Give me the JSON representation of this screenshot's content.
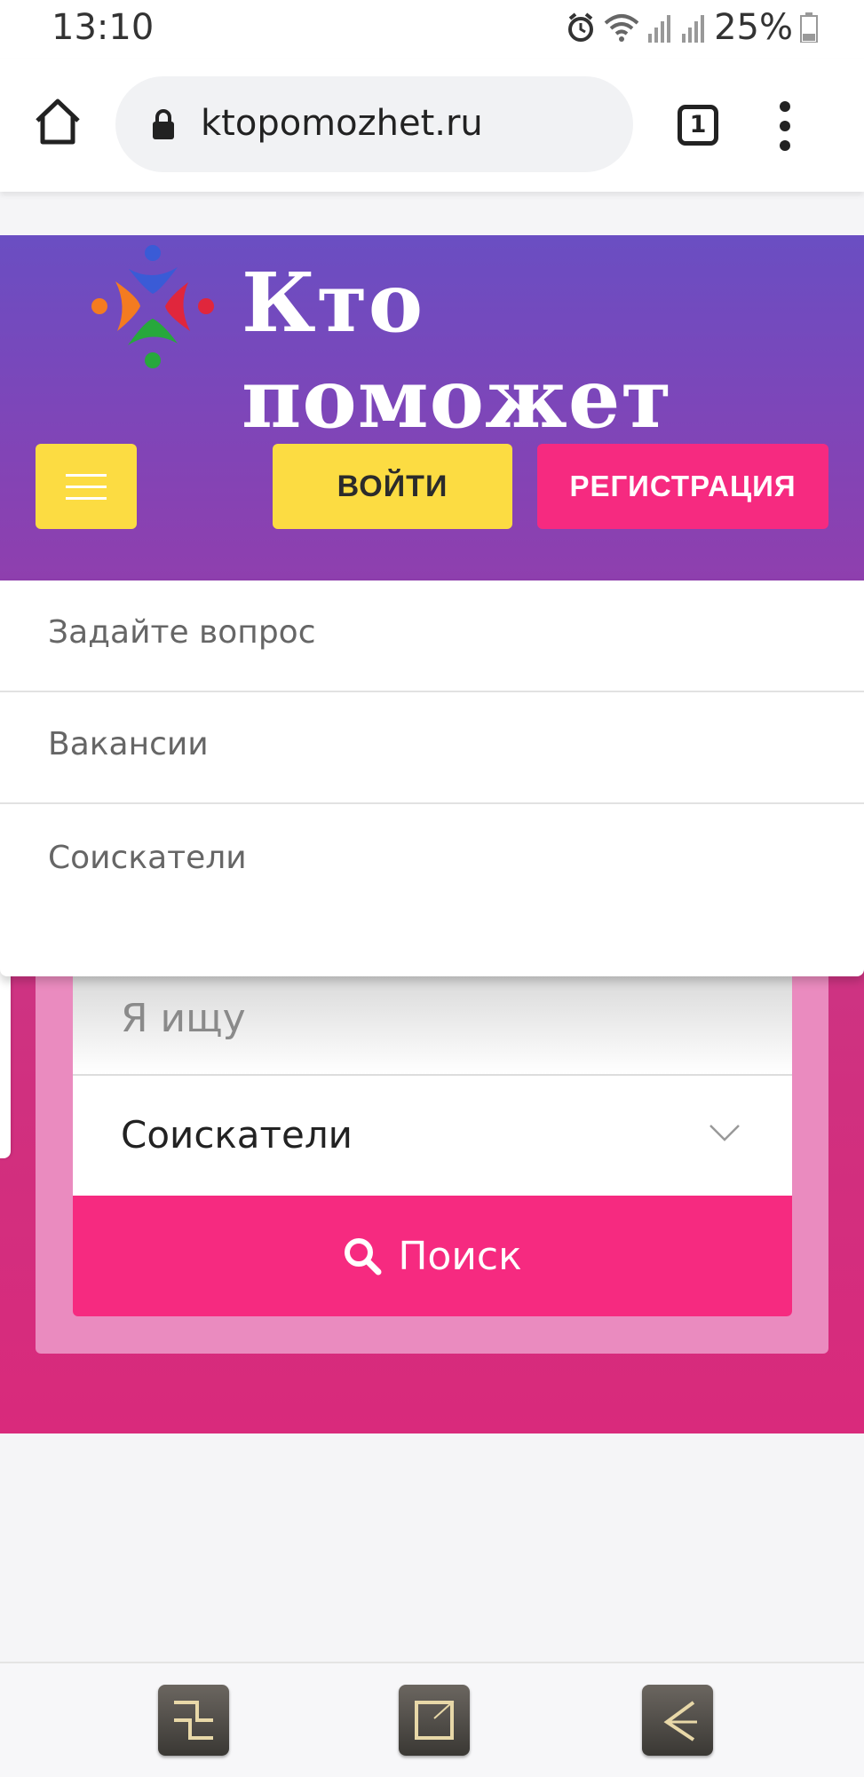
{
  "status_bar": {
    "time": "13:10",
    "battery": "25%"
  },
  "browser": {
    "url": "ktopomozhet.ru",
    "tab_count": "1"
  },
  "site": {
    "logo_text": "Кто поможет",
    "login_label": "ВОЙТИ",
    "register_label": "РЕГИСТРАЦИЯ"
  },
  "menu": {
    "items": [
      {
        "label": "Задайте вопрос"
      },
      {
        "label": "Вакансии"
      },
      {
        "label": "Соискатели"
      }
    ]
  },
  "search": {
    "placeholder": "Я ищу",
    "selected_category": "Соискатели",
    "button_label": "Поиск"
  },
  "colors": {
    "header": "#6a4ec2",
    "accent_yellow": "#fcdc42",
    "accent_pink": "#f62a80",
    "hero_pink": "#d0307f"
  },
  "icons": {
    "home": "home-icon",
    "lock": "lock-icon",
    "menu": "menu-icon",
    "search": "search-icon",
    "chevron": "chevron-down-icon"
  }
}
